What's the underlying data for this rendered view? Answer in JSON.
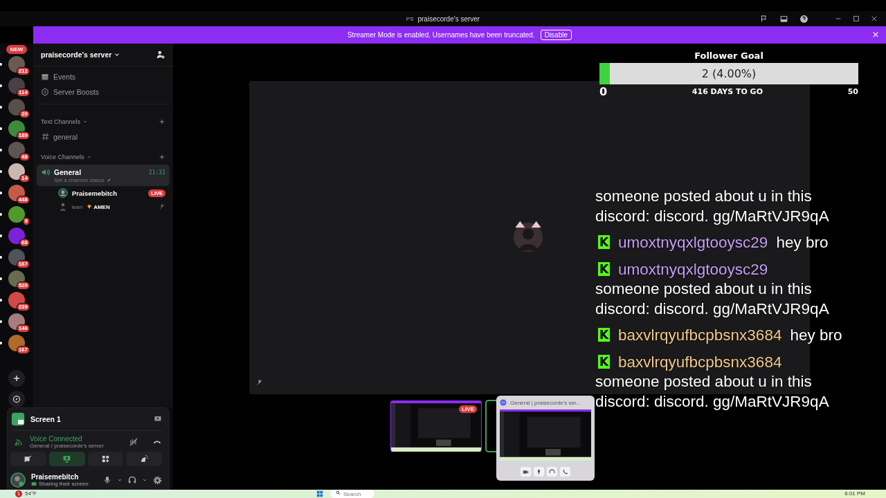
{
  "window": {
    "title": "praisecorde's server",
    "server_tag": "PS"
  },
  "banner": {
    "text": "Streamer Mode is enabled. Usernames have been truncated.",
    "button": "Disable"
  },
  "servers": [
    {
      "badge": "212",
      "new_label": "NEW",
      "color": "#6b5a52"
    },
    {
      "badge": "114",
      "color": "#4a3f46"
    },
    {
      "badge": "20",
      "color": "#57504a"
    },
    {
      "badge": "189",
      "color": "#3f8a3a"
    },
    {
      "badge": "48",
      "color": "#5d5550"
    },
    {
      "badge": "14",
      "color": "#c9b8b0"
    },
    {
      "badge": "448",
      "color": "#c45a4a"
    },
    {
      "badge": "9",
      "color": "#4f9a2a"
    },
    {
      "badge": "68",
      "color": "#7a22d8"
    },
    {
      "badge": "167",
      "color": "#50545a"
    },
    {
      "badge": "520",
      "color": "#6a6a50"
    },
    {
      "badge": "239",
      "color": "#d04848"
    },
    {
      "badge": "146",
      "color": "#a87c7c"
    },
    {
      "badge": "167",
      "color": "#b06a2a"
    }
  ],
  "sidebar": {
    "server_name": "praisecorde's server",
    "items": [
      "Events",
      "Server Boosts"
    ],
    "categories": [
      {
        "name": "Text Channels",
        "channels": [
          {
            "kind": "text",
            "name": "general",
            "selected": false
          }
        ]
      },
      {
        "name": "Voice Channels",
        "channels": [
          {
            "kind": "voice",
            "name": "General",
            "selected": true,
            "time": "21:31",
            "status": "Set a channel status",
            "members": [
              {
                "name": "Praisemebitch",
                "badge": "LIVE"
              },
              {
                "name": "leen",
                "tag": "AMEN"
              }
            ]
          }
        ]
      }
    ]
  },
  "user_panel": {
    "stream": "Screen 1",
    "connection": "Voice Connected",
    "location": "General / praisecorde's server",
    "controls": [
      {
        "active": false
      },
      {
        "active": true
      },
      {
        "active": false
      },
      {
        "active": false
      }
    ],
    "user": "Praisemebitch",
    "activity": "Sharing their screen"
  },
  "goal": {
    "title": "Follower Goal",
    "value": "2 (4.00%)",
    "level": 0.04,
    "min": "0",
    "remaining": "416 DAYS TO GO",
    "max": "50"
  },
  "chat": [
    {
      "color": "#ffffff",
      "text": "someone posted about u in this discord: discord. gg/MaRtVJR9qA"
    },
    {
      "badge": "K",
      "user": "umoxtnyqxlgtooysc29",
      "color": "#c89cf5",
      "text": "hey bro"
    },
    {
      "badge": "K",
      "user": "umoxtnyqxlgtooysc29",
      "color": "#c89cf5",
      "text": "someone posted about u in this discord: discord. gg/MaRtVJR9qA"
    },
    {
      "badge": "K",
      "user": "baxvlrqyufbcpbsnx3684",
      "color": "#f2c98a",
      "text": "hey bro"
    },
    {
      "badge": "K",
      "user": "baxvlrqyufbcpbsnx3684",
      "color": "#f2c98a",
      "text": "someone posted about u in this discord: discord. gg/MaRtVJR9qA"
    }
  ],
  "previews": {
    "live_label": "LIVE",
    "popup_title": "General | praisecorde's ser..."
  },
  "taskbar": {
    "weather": "54°F",
    "alert": "1",
    "search_placeholder": "Search",
    "time": "6:01 PM"
  }
}
